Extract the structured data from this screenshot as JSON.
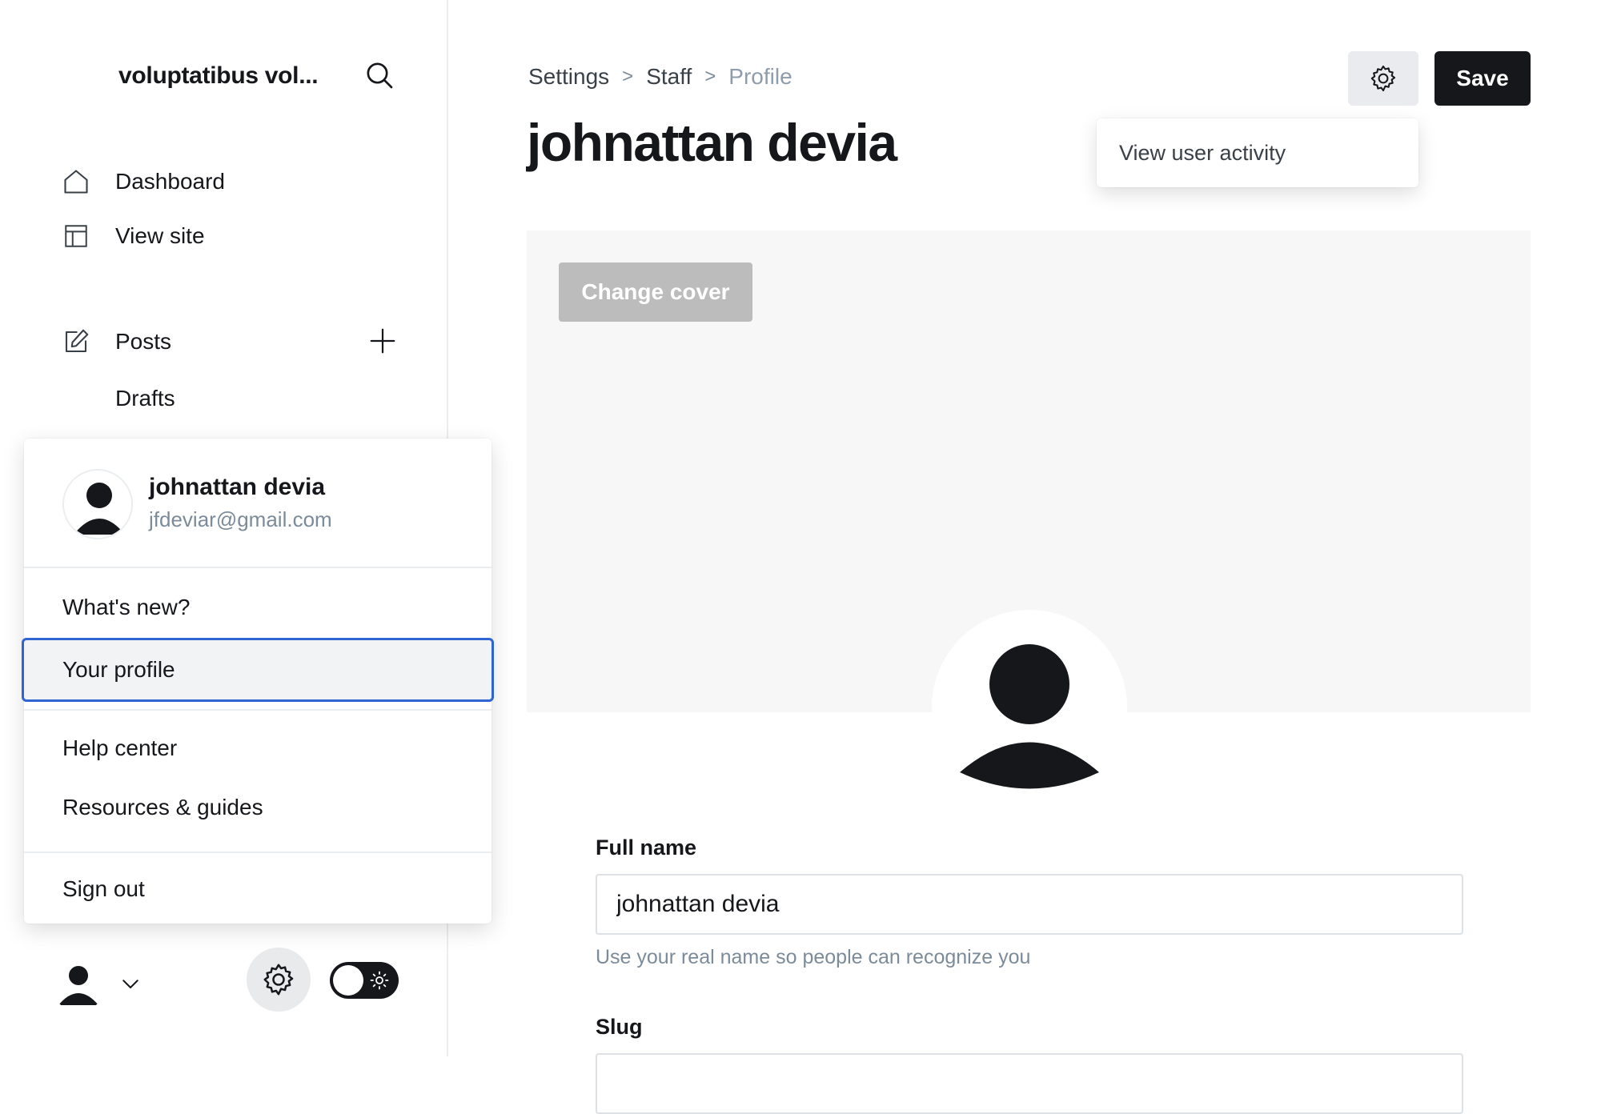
{
  "sidebar": {
    "site_title": "voluptatibus vol...",
    "nav": {
      "dashboard": "Dashboard",
      "view_site": "View site",
      "posts": "Posts",
      "drafts": "Drafts"
    }
  },
  "user_menu": {
    "name": "johnattan devia",
    "email": "jfdeviar@gmail.com",
    "items": {
      "whats_new": "What's new?",
      "your_profile": "Your profile",
      "help_center": "Help center",
      "resources": "Resources & guides",
      "sign_out": "Sign out"
    }
  },
  "header": {
    "breadcrumb": [
      "Settings",
      "Staff",
      "Profile"
    ],
    "title": "johnattan devia",
    "save_label": "Save"
  },
  "actions_menu": {
    "item": "View user activity"
  },
  "cover": {
    "change_cover_label": "Change cover"
  },
  "form": {
    "full_name": {
      "label": "Full name",
      "value": "johnattan devia",
      "hint": "Use your real name so people can recognize you"
    },
    "slug": {
      "label": "Slug",
      "value": ""
    }
  },
  "icons": {
    "search": "search-icon",
    "home": "home-icon",
    "layout": "layout-icon",
    "edit": "edit-icon",
    "plus": "plus-icon",
    "gear": "gear-icon",
    "chevron": "chevron-down-icon",
    "sun": "sun-icon",
    "avatar": "avatar-icon"
  },
  "colors": {
    "primary": "#15171a",
    "focus_outline": "#3064d0",
    "muted_text": "#7c8b9a",
    "cover_bg": "#f7f7f7"
  }
}
